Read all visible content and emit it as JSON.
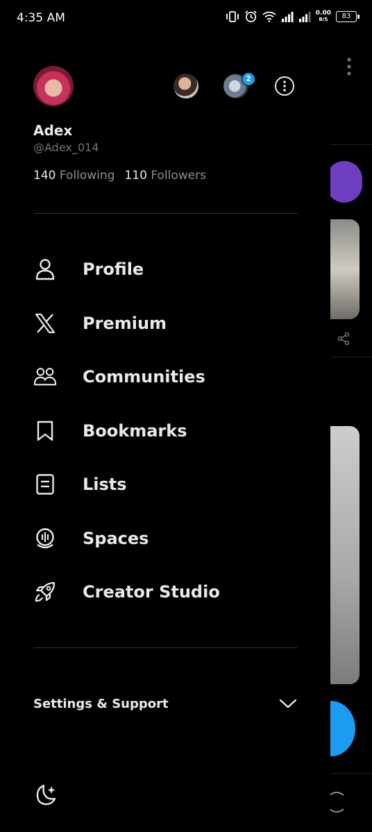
{
  "status_bar": {
    "time": "4:35 AM",
    "net_speed_value": "0.00",
    "net_speed_unit": "B/S",
    "battery": "83"
  },
  "profile": {
    "name": "Adex",
    "handle": "@Adex_014",
    "following_count": "140",
    "following_label": "Following",
    "followers_count": "110",
    "followers_label": "Followers",
    "account_switcher_badge": "2"
  },
  "menu": {
    "items": [
      {
        "label": "Profile",
        "icon": "person-icon"
      },
      {
        "label": "Premium",
        "icon": "x-logo-icon"
      },
      {
        "label": "Communities",
        "icon": "communities-icon"
      },
      {
        "label": "Bookmarks",
        "icon": "bookmark-icon"
      },
      {
        "label": "Lists",
        "icon": "list-icon"
      },
      {
        "label": "Spaces",
        "icon": "spaces-icon"
      },
      {
        "label": "Creator Studio",
        "icon": "rocket-icon"
      }
    ]
  },
  "settings": {
    "label": "Settings & Support"
  },
  "colors": {
    "background": "#000000",
    "text": "#e7e9ea",
    "muted": "#71767b",
    "accent": "#1d9bf0",
    "divider": "#2f3336"
  }
}
